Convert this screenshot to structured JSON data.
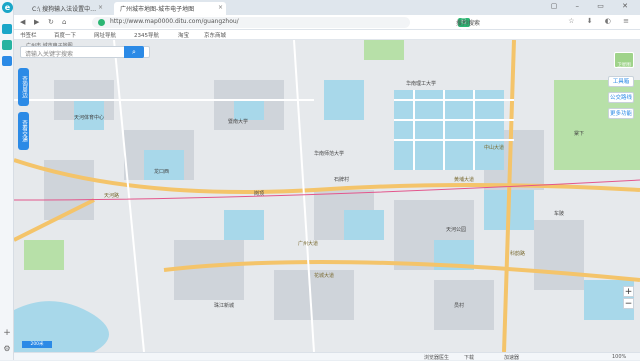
{
  "browser": {
    "tabs": [
      {
        "label": "C:\\ 搜狗输入法设置中…"
      },
      {
        "label": "广州城市地图-城市电子地图"
      }
    ],
    "url": "http://www.map0000.ditu.com/guangzhou/",
    "login_tag": "已登录 | 图片",
    "search_placeholder": "搜狗搜索",
    "bookmarks": [
      "书签栏",
      "百度一下",
      "网址导航",
      "2345导航",
      "淘宝",
      "京东商城"
    ]
  },
  "map": {
    "breadcrumb": "广州市 城市电子地图",
    "search_placeholder": "请输入关键字搜索",
    "side_tabs": [
      "查询周边",
      "查看交通"
    ],
    "layer_label": "卫星图",
    "tools": [
      "工具箱",
      "公交路线",
      "更多功能"
    ],
    "scale_label": "200米",
    "labels": [
      {
        "text": "天河体育中心",
        "cls": ""
      },
      {
        "text": "华南理工大学",
        "cls": ""
      },
      {
        "text": "中山大道",
        "cls": "road"
      },
      {
        "text": "黄埔大道",
        "cls": "road"
      },
      {
        "text": "天河路",
        "cls": "road"
      },
      {
        "text": "广州大道",
        "cls": "road"
      },
      {
        "text": "暨南大学",
        "cls": ""
      },
      {
        "text": "华南师范大学",
        "cls": ""
      },
      {
        "text": "石牌村",
        "cls": ""
      },
      {
        "text": "龙口西",
        "cls": ""
      },
      {
        "text": "岗顶",
        "cls": ""
      },
      {
        "text": "天河公园",
        "cls": ""
      },
      {
        "text": "车陂",
        "cls": ""
      },
      {
        "text": "棠下",
        "cls": ""
      },
      {
        "text": "珠江新城",
        "cls": ""
      },
      {
        "text": "员村",
        "cls": ""
      },
      {
        "text": "花城大道",
        "cls": "road"
      },
      {
        "text": "科韵路",
        "cls": "road"
      }
    ]
  },
  "status": {
    "items": [
      "浏览器医生",
      "下载",
      "加速器",
      "100%"
    ]
  },
  "colors": {
    "accent": "#2b8ae6",
    "water": "#a8d8ea",
    "green": "#b7e0a8",
    "road": "#f4c46a"
  }
}
